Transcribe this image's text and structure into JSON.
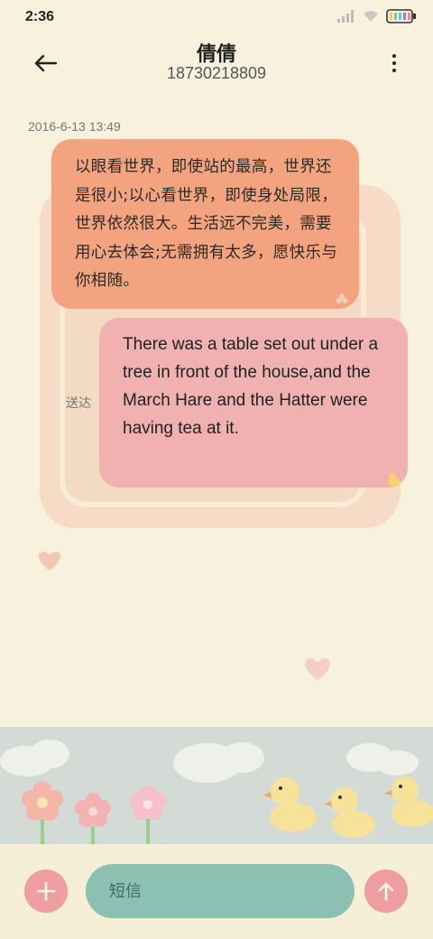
{
  "status_bar": {
    "time": "2:36",
    "icons": [
      "signal-icon",
      "wifi-icon",
      "battery-icon"
    ]
  },
  "header": {
    "back_icon": "arrow-left-icon",
    "title": "倩倩",
    "phone_number": "18730218809",
    "more_icon": "more-vertical-icon"
  },
  "conversation": {
    "timestamp": "2016-6-13 13:49",
    "messages": [
      {
        "direction": "incoming",
        "text": "以眼看世界，即使站的最高，世界还是很小;以心看世界，即使身处局限，世界依然很大。生活远不完美，需要用心去体会;无需拥有太多，愿快乐与你相随。"
      },
      {
        "direction": "outgoing",
        "text": "There was a table set out under a tree in front of the house,and the March Hare and the Hatter were having tea at it.",
        "status": "送达"
      }
    ]
  },
  "composer": {
    "add_icon": "plus-icon",
    "placeholder": "短信",
    "send_icon": "arrow-up-icon"
  },
  "colors": {
    "background": "#f7f1dd",
    "incoming_bubble": "#f3a47f",
    "outgoing_bubble": "#efb2b0",
    "input": "#8bc0b2",
    "buttons": "#ee9da0"
  }
}
